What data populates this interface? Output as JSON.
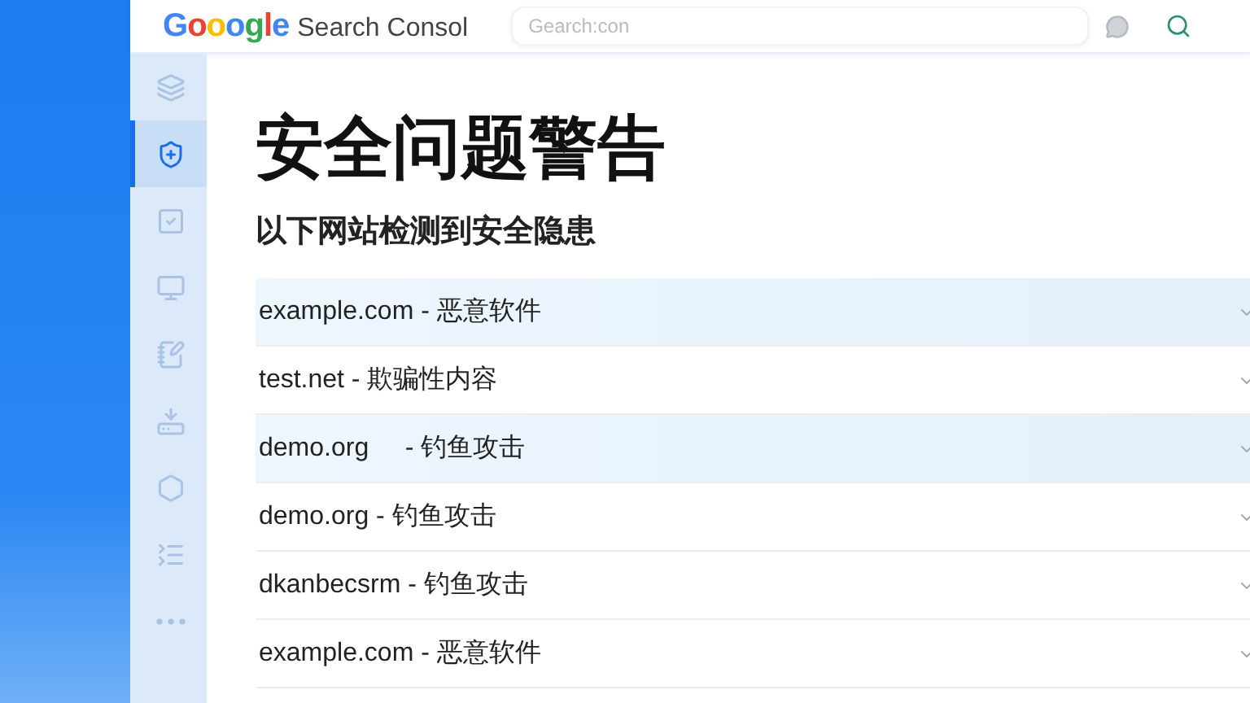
{
  "header": {
    "logo_mark": "Gooogle",
    "product": "Search Consol",
    "search": {
      "placeholder": "Gearch:con"
    }
  },
  "sidebar": {
    "items": [
      {
        "selected": false
      },
      {
        "selected": true
      },
      {
        "selected": false
      },
      {
        "selected": false
      },
      {
        "selected": false
      },
      {
        "selected": false
      },
      {
        "selected": false
      },
      {
        "selected": false
      },
      {
        "selected": false
      }
    ]
  },
  "title": "安全问题警告",
  "subtitle": "以下网站检测到安全隐患",
  "issues": [
    {
      "label": "example.com - 恶意软件",
      "highlighted": true
    },
    {
      "label": "test.net - 欺骗性内容",
      "highlighted": false
    },
    {
      "label": "demo.org     - 钓鱼攻击",
      "highlighted": true
    },
    {
      "label": "demo.org - 钓鱼攻击",
      "highlighted": false
    },
    {
      "label": "dkanbecsrm - 钓鱼攻击",
      "highlighted": false
    },
    {
      "label": "example.com - 恶意软件",
      "highlighted": false
    }
  ]
}
